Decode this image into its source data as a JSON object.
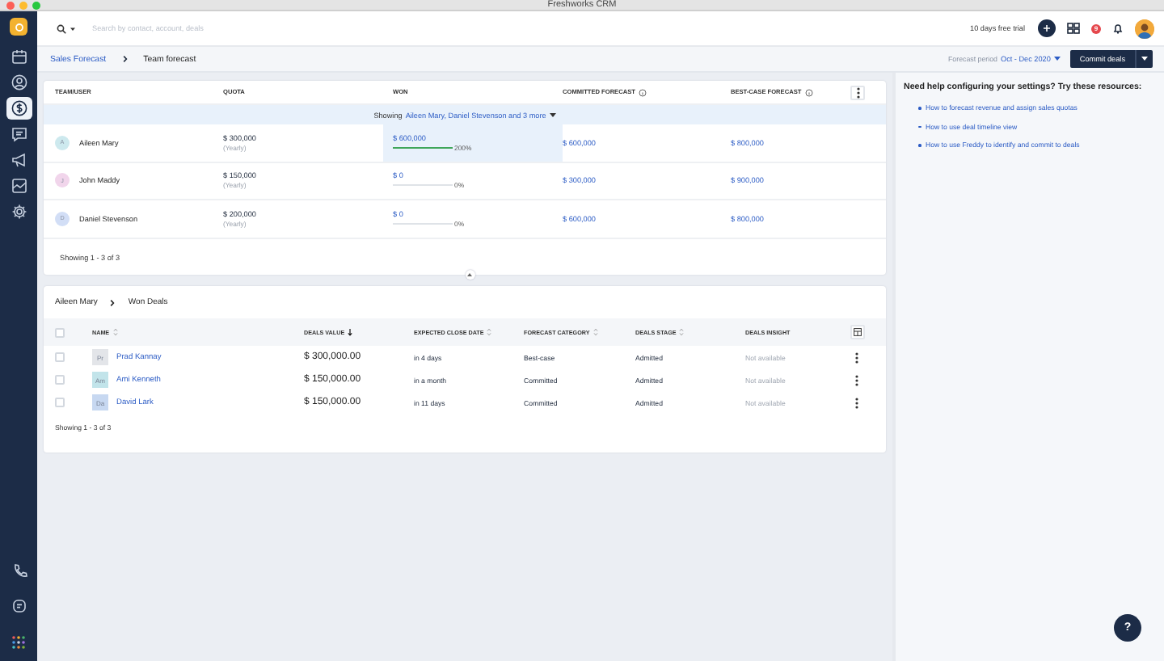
{
  "window": {
    "title": "Freshworks CRM"
  },
  "sidebar": {
    "items": [
      {
        "selected": false
      },
      {
        "selected": false
      },
      {
        "selected": true
      },
      {
        "selected": false
      },
      {
        "selected": false
      },
      {
        "selected": false
      },
      {
        "selected": false
      }
    ]
  },
  "header": {
    "search": {
      "placeholder": "Search by contact, account, deals"
    },
    "trial": "10 days free trial",
    "notifications": "9"
  },
  "subbar": {
    "breadcrumb": [
      "Sales Forecast",
      "Team forecast"
    ],
    "period_label": "Forecast period",
    "period": "Oct - Dec 2020",
    "commit_button": "Commit deals"
  },
  "forecast": {
    "columns": [
      {
        "label": "TEAM/USER",
        "info": false
      },
      {
        "label": "QUOTA",
        "info": false
      },
      {
        "label": "WON",
        "info": false
      },
      {
        "label": "COMMITTED FORECAST",
        "info": true
      },
      {
        "label": "BEST-CASE FORECAST",
        "info": true
      }
    ],
    "showing": {
      "prefix": "Showing",
      "link": "Aileen Mary, Daniel Stevenson and 3 more"
    },
    "rows": [
      {
        "name": "Aileen Mary",
        "initial": "A",
        "color": "#cde9ee",
        "quota": "$ 300,000",
        "period": "(Yearly)",
        "won": "$ 600,000",
        "level": 1,
        "percent": "200%",
        "selected": true,
        "committed": "$ 600,000",
        "best_case": "$ 800,000"
      },
      {
        "name": "John Maddy",
        "initial": "J",
        "color": "#f1d5eb",
        "quota": "$ 150,000",
        "period": "(Yearly)",
        "won": "$ 0",
        "level": 0,
        "percent": "0%",
        "selected": false,
        "committed": "$ 300,000",
        "best_case": "$ 900,000"
      },
      {
        "name": "Daniel Stevenson",
        "initial": "D",
        "color": "#d2def6",
        "quota": "$ 200,000",
        "period": "(Yearly)",
        "won": "$ 0",
        "level": 0,
        "percent": "0%",
        "selected": false,
        "committed": "$ 600,000",
        "best_case": "$ 800,000"
      }
    ],
    "footer": "Showing 1 - 3 of 3"
  },
  "deals": {
    "breadcrumb": [
      "Aileen Mary",
      "Won Deals"
    ],
    "all_checked": false,
    "columns": [
      {
        "label": "NAME",
        "sortable": true,
        "sorted": false
      },
      {
        "label": "DEALS VALUE",
        "sortable": true,
        "sorted": true
      },
      {
        "label": "EXPECTED CLOSE DATE",
        "sortable": true,
        "sorted": false
      },
      {
        "label": "FORECAST CATEGORY",
        "sortable": true,
        "sorted": false
      },
      {
        "label": "DEALS STAGE",
        "sortable": true,
        "sorted": false
      },
      {
        "label": "DEALS INSIGHT",
        "sortable": false,
        "sorted": false
      }
    ],
    "rows": [
      {
        "checked": false,
        "initials": "Pr",
        "color": "#e3e5e9",
        "name": "Prad Kannay",
        "value": "$ 300,000.00",
        "close": "in 4 days",
        "category": "Best-case",
        "stage": "Admitted",
        "insight": "Not available"
      },
      {
        "checked": false,
        "initials": "Am",
        "color": "#c2e4ea",
        "name": "Ami Kenneth",
        "value": "$ 150,000.00",
        "close": "in a month",
        "category": "Committed",
        "stage": "Admitted",
        "insight": "Not available"
      },
      {
        "checked": false,
        "initials": "Da",
        "color": "#c7d8f1",
        "name": "David Lark",
        "value": "$ 150,000.00",
        "close": "in 11 days",
        "category": "Committed",
        "stage": "Admitted",
        "insight": "Not available"
      }
    ],
    "footer": "Showing 1 - 3 of 3"
  },
  "help": {
    "title": "Need help configuring your settings? Try these resources:",
    "links": [
      "How to forecast revenue and assign sales quotas",
      "How to use deal timeline view",
      "How to use Freddy to identify and commit to deals"
    ]
  },
  "help_button": "?"
}
